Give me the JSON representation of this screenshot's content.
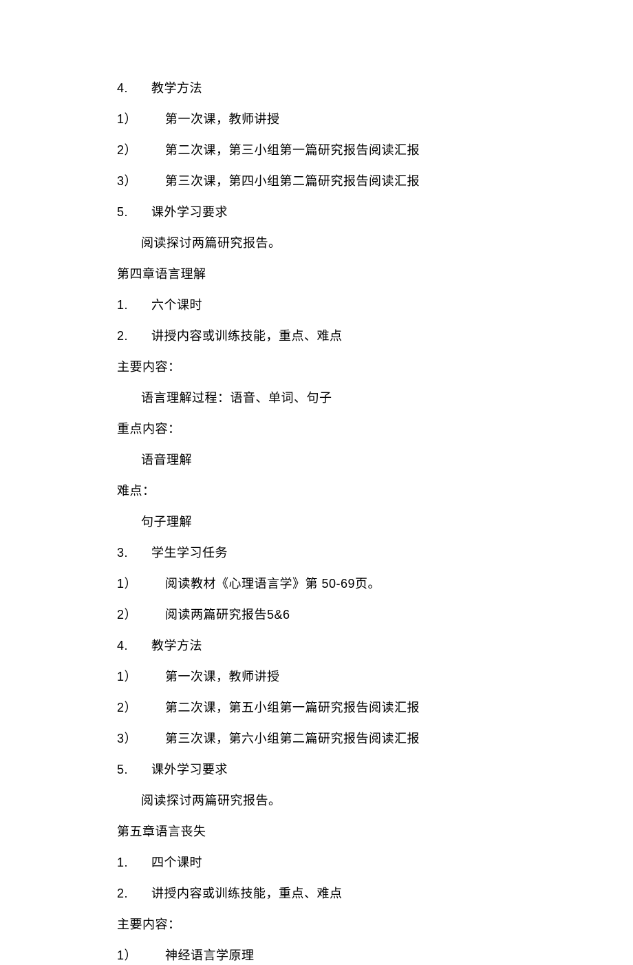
{
  "lines": [
    {
      "cls": "indent-1",
      "prefix": "4. ",
      "text": "教学方法"
    },
    {
      "cls": "indent-1",
      "prefix": "1）",
      "wide": true,
      "text": "第一次课，教师讲授"
    },
    {
      "cls": "indent-1",
      "prefix": "2）",
      "wide": true,
      "text": "第二次课，第三小组第一篇研究报告阅读汇报"
    },
    {
      "cls": "indent-1",
      "prefix": "3）",
      "wide": true,
      "text": "第三次课，第四小组第二篇研究报告阅读汇报"
    },
    {
      "cls": "indent-1",
      "prefix": "5. ",
      "text": "课外学习要求"
    },
    {
      "cls": "indent-2",
      "prefix": "",
      "text": "阅读探讨两篇研究报告。"
    },
    {
      "cls": "indent-1",
      "prefix": "",
      "text": "第四章语言理解"
    },
    {
      "cls": "indent-1",
      "prefix": "1. ",
      "text": "六个课时"
    },
    {
      "cls": "indent-1",
      "prefix": "2. ",
      "text": "讲授内容或训练技能，重点、难点"
    },
    {
      "cls": "indent-1",
      "prefix": "",
      "text": "主要内容："
    },
    {
      "cls": "indent-2",
      "prefix": "",
      "text": "语言理解过程：语音、单词、句子"
    },
    {
      "cls": "indent-1",
      "prefix": "",
      "text": "重点内容："
    },
    {
      "cls": "indent-2",
      "prefix": "",
      "text": "语音理解"
    },
    {
      "cls": "indent-1",
      "prefix": "",
      "text": "难点："
    },
    {
      "cls": "indent-2",
      "prefix": "",
      "text": "句子理解"
    },
    {
      "cls": "indent-1",
      "prefix": "3. ",
      "text": "学生学习任务"
    },
    {
      "cls": "indent-1",
      "prefix": "1）",
      "wide": true,
      "text": "阅读教材《心理语言学》第 50-69页。"
    },
    {
      "cls": "indent-1",
      "prefix": "2）",
      "wide": true,
      "text": "阅读两篇研究报告5&6"
    },
    {
      "cls": "indent-1",
      "prefix": "4. ",
      "text": "教学方法"
    },
    {
      "cls": "indent-1",
      "prefix": "1）",
      "wide": true,
      "text": "第一次课，教师讲授"
    },
    {
      "cls": "indent-1",
      "prefix": "2）",
      "wide": true,
      "text": "第二次课，第五小组第一篇研究报告阅读汇报"
    },
    {
      "cls": "indent-1",
      "prefix": "3）",
      "wide": true,
      "text": "第三次课，第六小组第二篇研究报告阅读汇报"
    },
    {
      "cls": "indent-1",
      "prefix": "5. ",
      "text": "课外学习要求"
    },
    {
      "cls": "indent-2",
      "prefix": "",
      "text": "阅读探讨两篇研究报告。"
    },
    {
      "cls": "indent-1",
      "prefix": "",
      "text": "第五章语言丧失"
    },
    {
      "cls": "indent-1",
      "prefix": "1. ",
      "text": "四个课时"
    },
    {
      "cls": "indent-1 extra-gap",
      "prefix": "2. ",
      "text": "讲授内容或训练技能，重点、难点"
    },
    {
      "cls": "indent-1",
      "prefix": "",
      "text": "主要内容："
    },
    {
      "cls": "indent-1",
      "prefix": " 1）",
      "wide": true,
      "text": "神经语言学原理"
    }
  ]
}
